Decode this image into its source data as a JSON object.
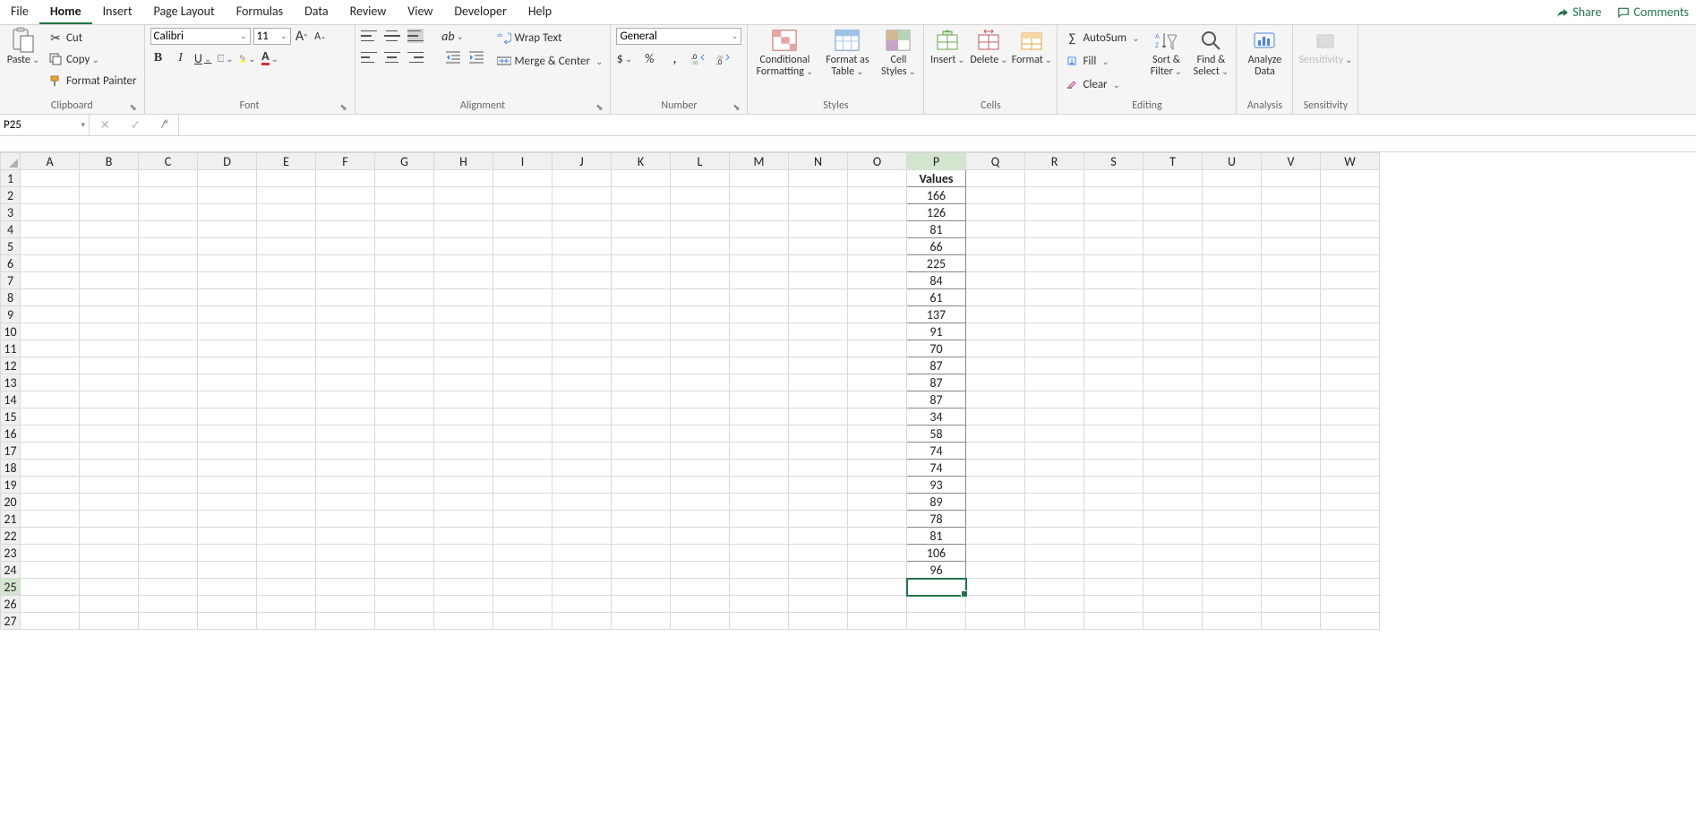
{
  "tabs": [
    "File",
    "Home",
    "Insert",
    "Page Layout",
    "Formulas",
    "Data",
    "Review",
    "View",
    "Developer",
    "Help"
  ],
  "active_tab": "Home",
  "share": "Share",
  "comments": "Comments",
  "clipboard": {
    "paste": "Paste",
    "cut": "Cut",
    "copy": "Copy",
    "format_painter": "Format Painter",
    "label": "Clipboard"
  },
  "font": {
    "name": "Calibri",
    "size": "11",
    "label": "Font"
  },
  "alignment": {
    "wrap": "Wrap Text",
    "merge": "Merge & Center",
    "label": "Alignment"
  },
  "number": {
    "format": "General",
    "label": "Number"
  },
  "styles": {
    "cond": "Conditional Formatting",
    "table": "Format as Table",
    "cell": "Cell Styles",
    "label": "Styles"
  },
  "cells": {
    "insert": "Insert",
    "delete": "Delete",
    "format": "Format",
    "label": "Cells"
  },
  "editing": {
    "autosum": "AutoSum",
    "fill": "Fill",
    "clear": "Clear",
    "sort": "Sort & Filter",
    "find": "Find & Select",
    "label": "Editing"
  },
  "analysis": {
    "analyze": "Analyze Data",
    "label": "Analysis"
  },
  "sensitivity": {
    "btn": "Sensitivity",
    "label": "Sensitivity"
  },
  "name_box": "P25",
  "formula": "",
  "columns": [
    "A",
    "B",
    "C",
    "D",
    "E",
    "F",
    "G",
    "H",
    "I",
    "J",
    "K",
    "L",
    "M",
    "N",
    "O",
    "P",
    "Q",
    "R",
    "S",
    "T",
    "U",
    "V",
    "W"
  ],
  "rows": [
    1,
    2,
    3,
    4,
    5,
    6,
    7,
    8,
    9,
    10,
    11,
    12,
    13,
    14,
    15,
    16,
    17,
    18,
    19,
    20,
    21,
    22,
    23,
    24,
    25,
    26,
    27
  ],
  "selected_cell": "P25",
  "data_col": "P",
  "data_header": "Values",
  "data_values": [
    166,
    126,
    81,
    66,
    225,
    84,
    61,
    137,
    91,
    70,
    87,
    87,
    87,
    34,
    58,
    74,
    74,
    93,
    89,
    78,
    81,
    106,
    96
  ]
}
